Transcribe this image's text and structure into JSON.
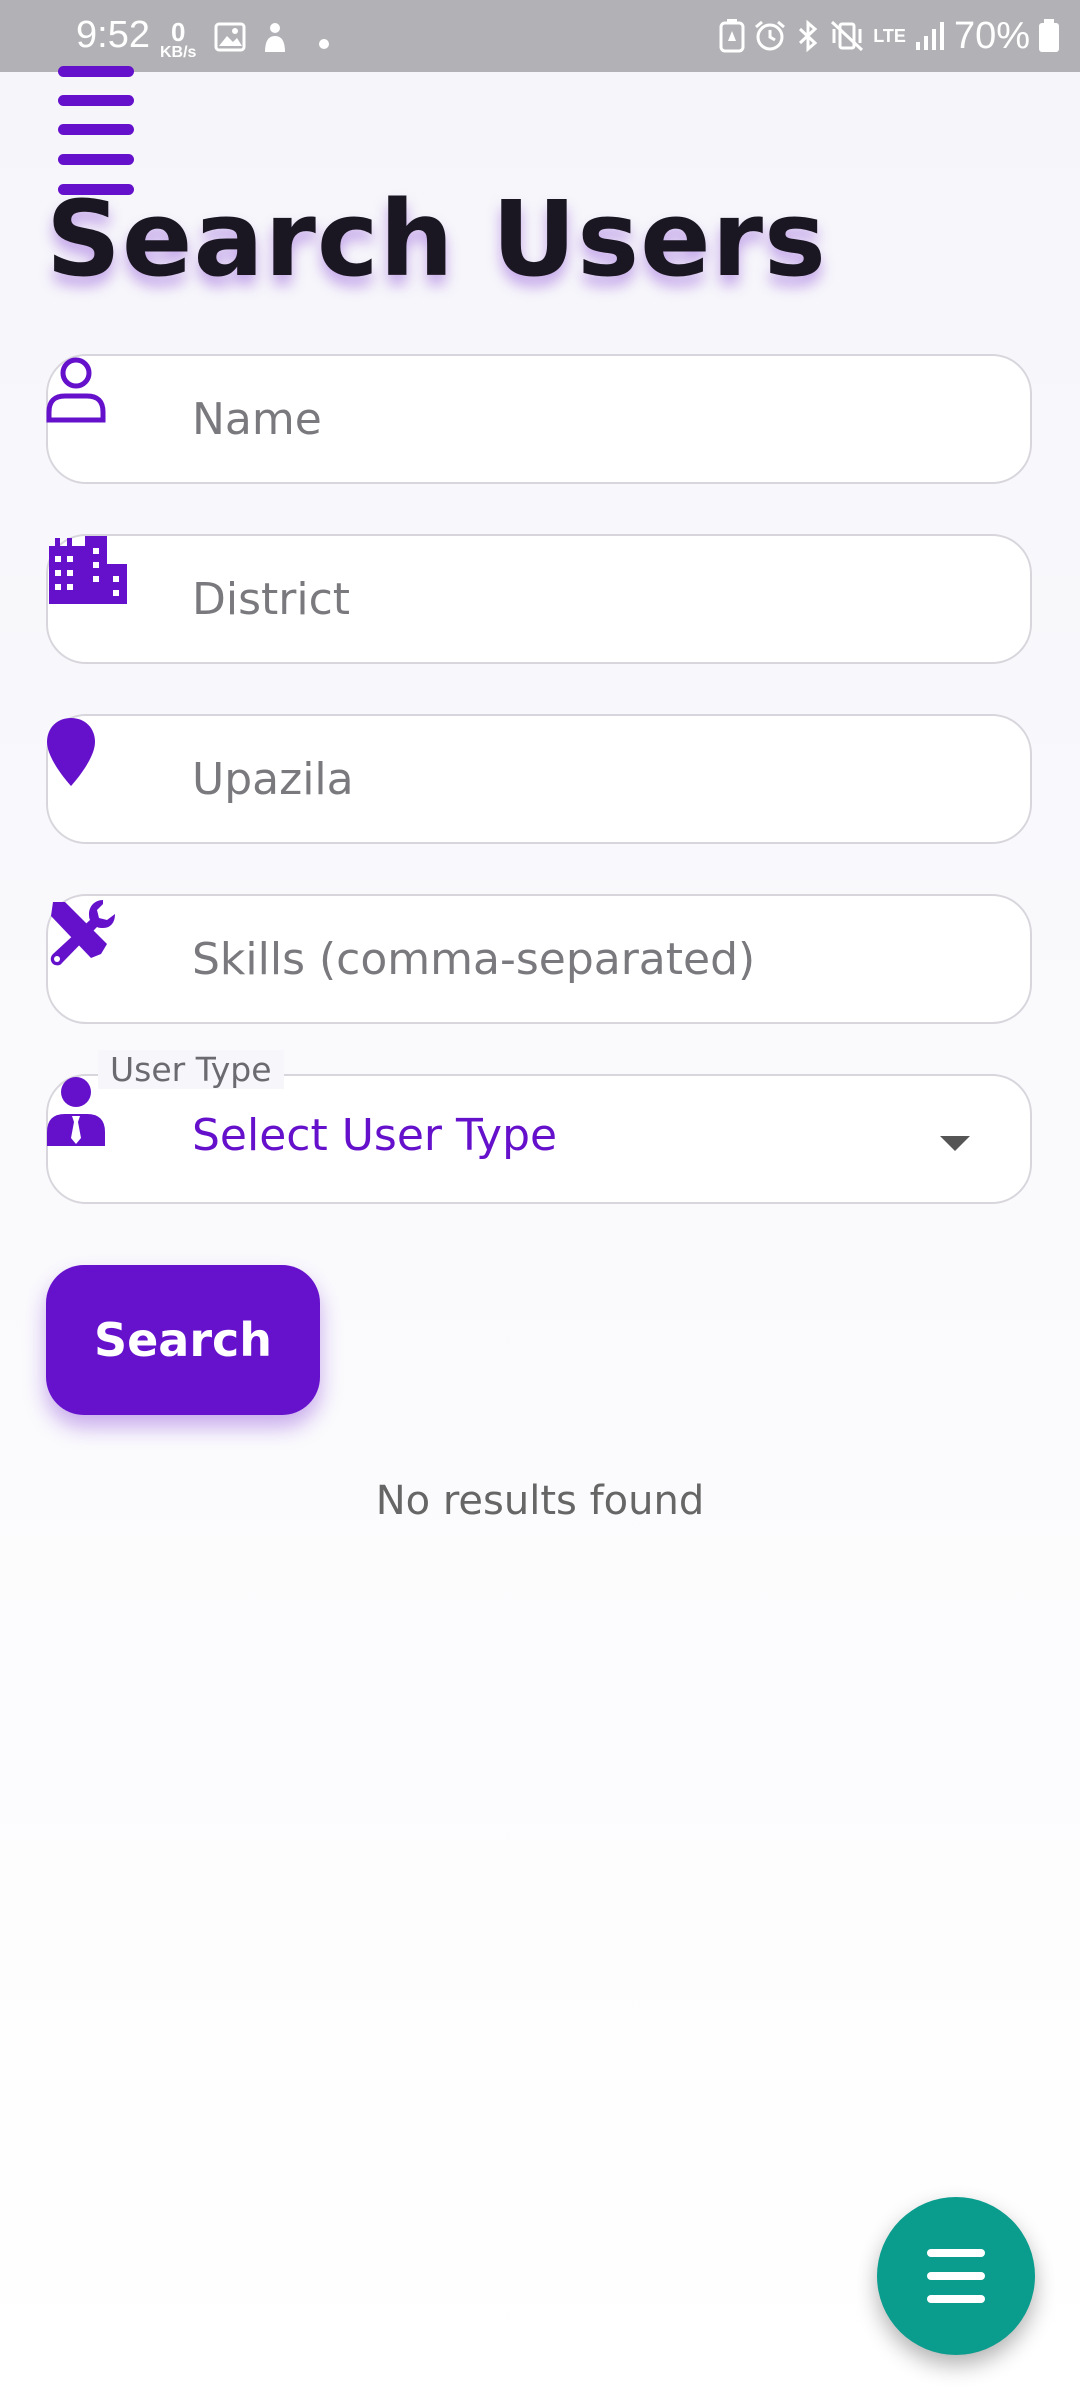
{
  "status_bar": {
    "time": "9:52",
    "data_rate_value": "0",
    "data_rate_unit": "KB/s",
    "network": "LTE",
    "battery": "70%"
  },
  "page": {
    "title": "Search Users"
  },
  "form": {
    "name": {
      "placeholder": "Name",
      "icon": "person-outline-icon"
    },
    "district": {
      "placeholder": "District",
      "icon": "city-icon"
    },
    "upazila": {
      "placeholder": "Upazila",
      "icon": "location-pin-icon"
    },
    "skills": {
      "placeholder": "Skills (comma-separated)",
      "icon": "tools-icon"
    },
    "user_type": {
      "label": "User Type",
      "value": "Select User Type",
      "icon": "user-tie-icon"
    }
  },
  "search_button": {
    "label": "Search"
  },
  "results": {
    "empty_text": "No results found"
  },
  "colors": {
    "accent": "#6511cc",
    "fab": "#0a9c8c",
    "title": "#1b1722"
  }
}
